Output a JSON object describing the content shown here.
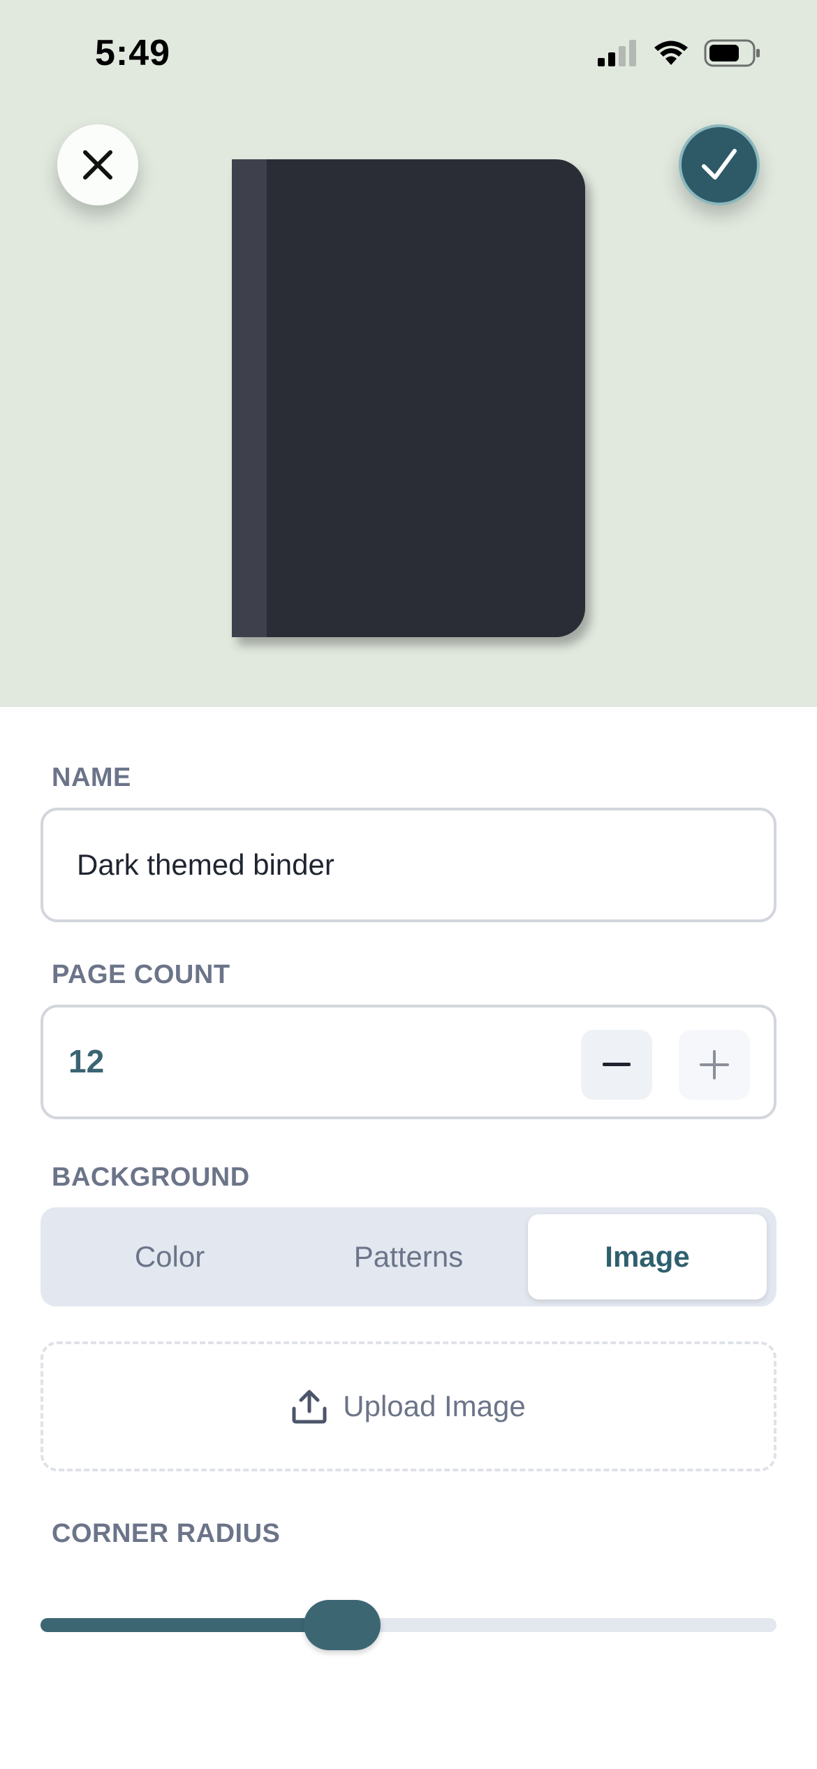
{
  "status_bar": {
    "time": "5:49"
  },
  "header": {
    "close_icon": "close-x-icon",
    "confirm_icon": "checkmark-icon"
  },
  "preview": {
    "binder_color": "#2a2d36",
    "spine_color": "#3e414c",
    "background": "#e1e9df"
  },
  "name": {
    "label": "NAME",
    "value": "Dark themed binder"
  },
  "page_count": {
    "label": "PAGE COUNT",
    "value": "12",
    "minus_icon": "minus-icon",
    "plus_icon": "plus-icon"
  },
  "background": {
    "label": "BACKGROUND",
    "options": [
      {
        "label": "Color",
        "selected": false
      },
      {
        "label": "Patterns",
        "selected": false
      },
      {
        "label": "Image",
        "selected": true
      }
    ],
    "upload_label": "Upload Image",
    "upload_icon": "upload-icon"
  },
  "corner_radius": {
    "label": "CORNER RADIUS",
    "value_fraction": 0.41
  },
  "colors": {
    "accent": "#2e5a68",
    "label": "#6b7489"
  }
}
